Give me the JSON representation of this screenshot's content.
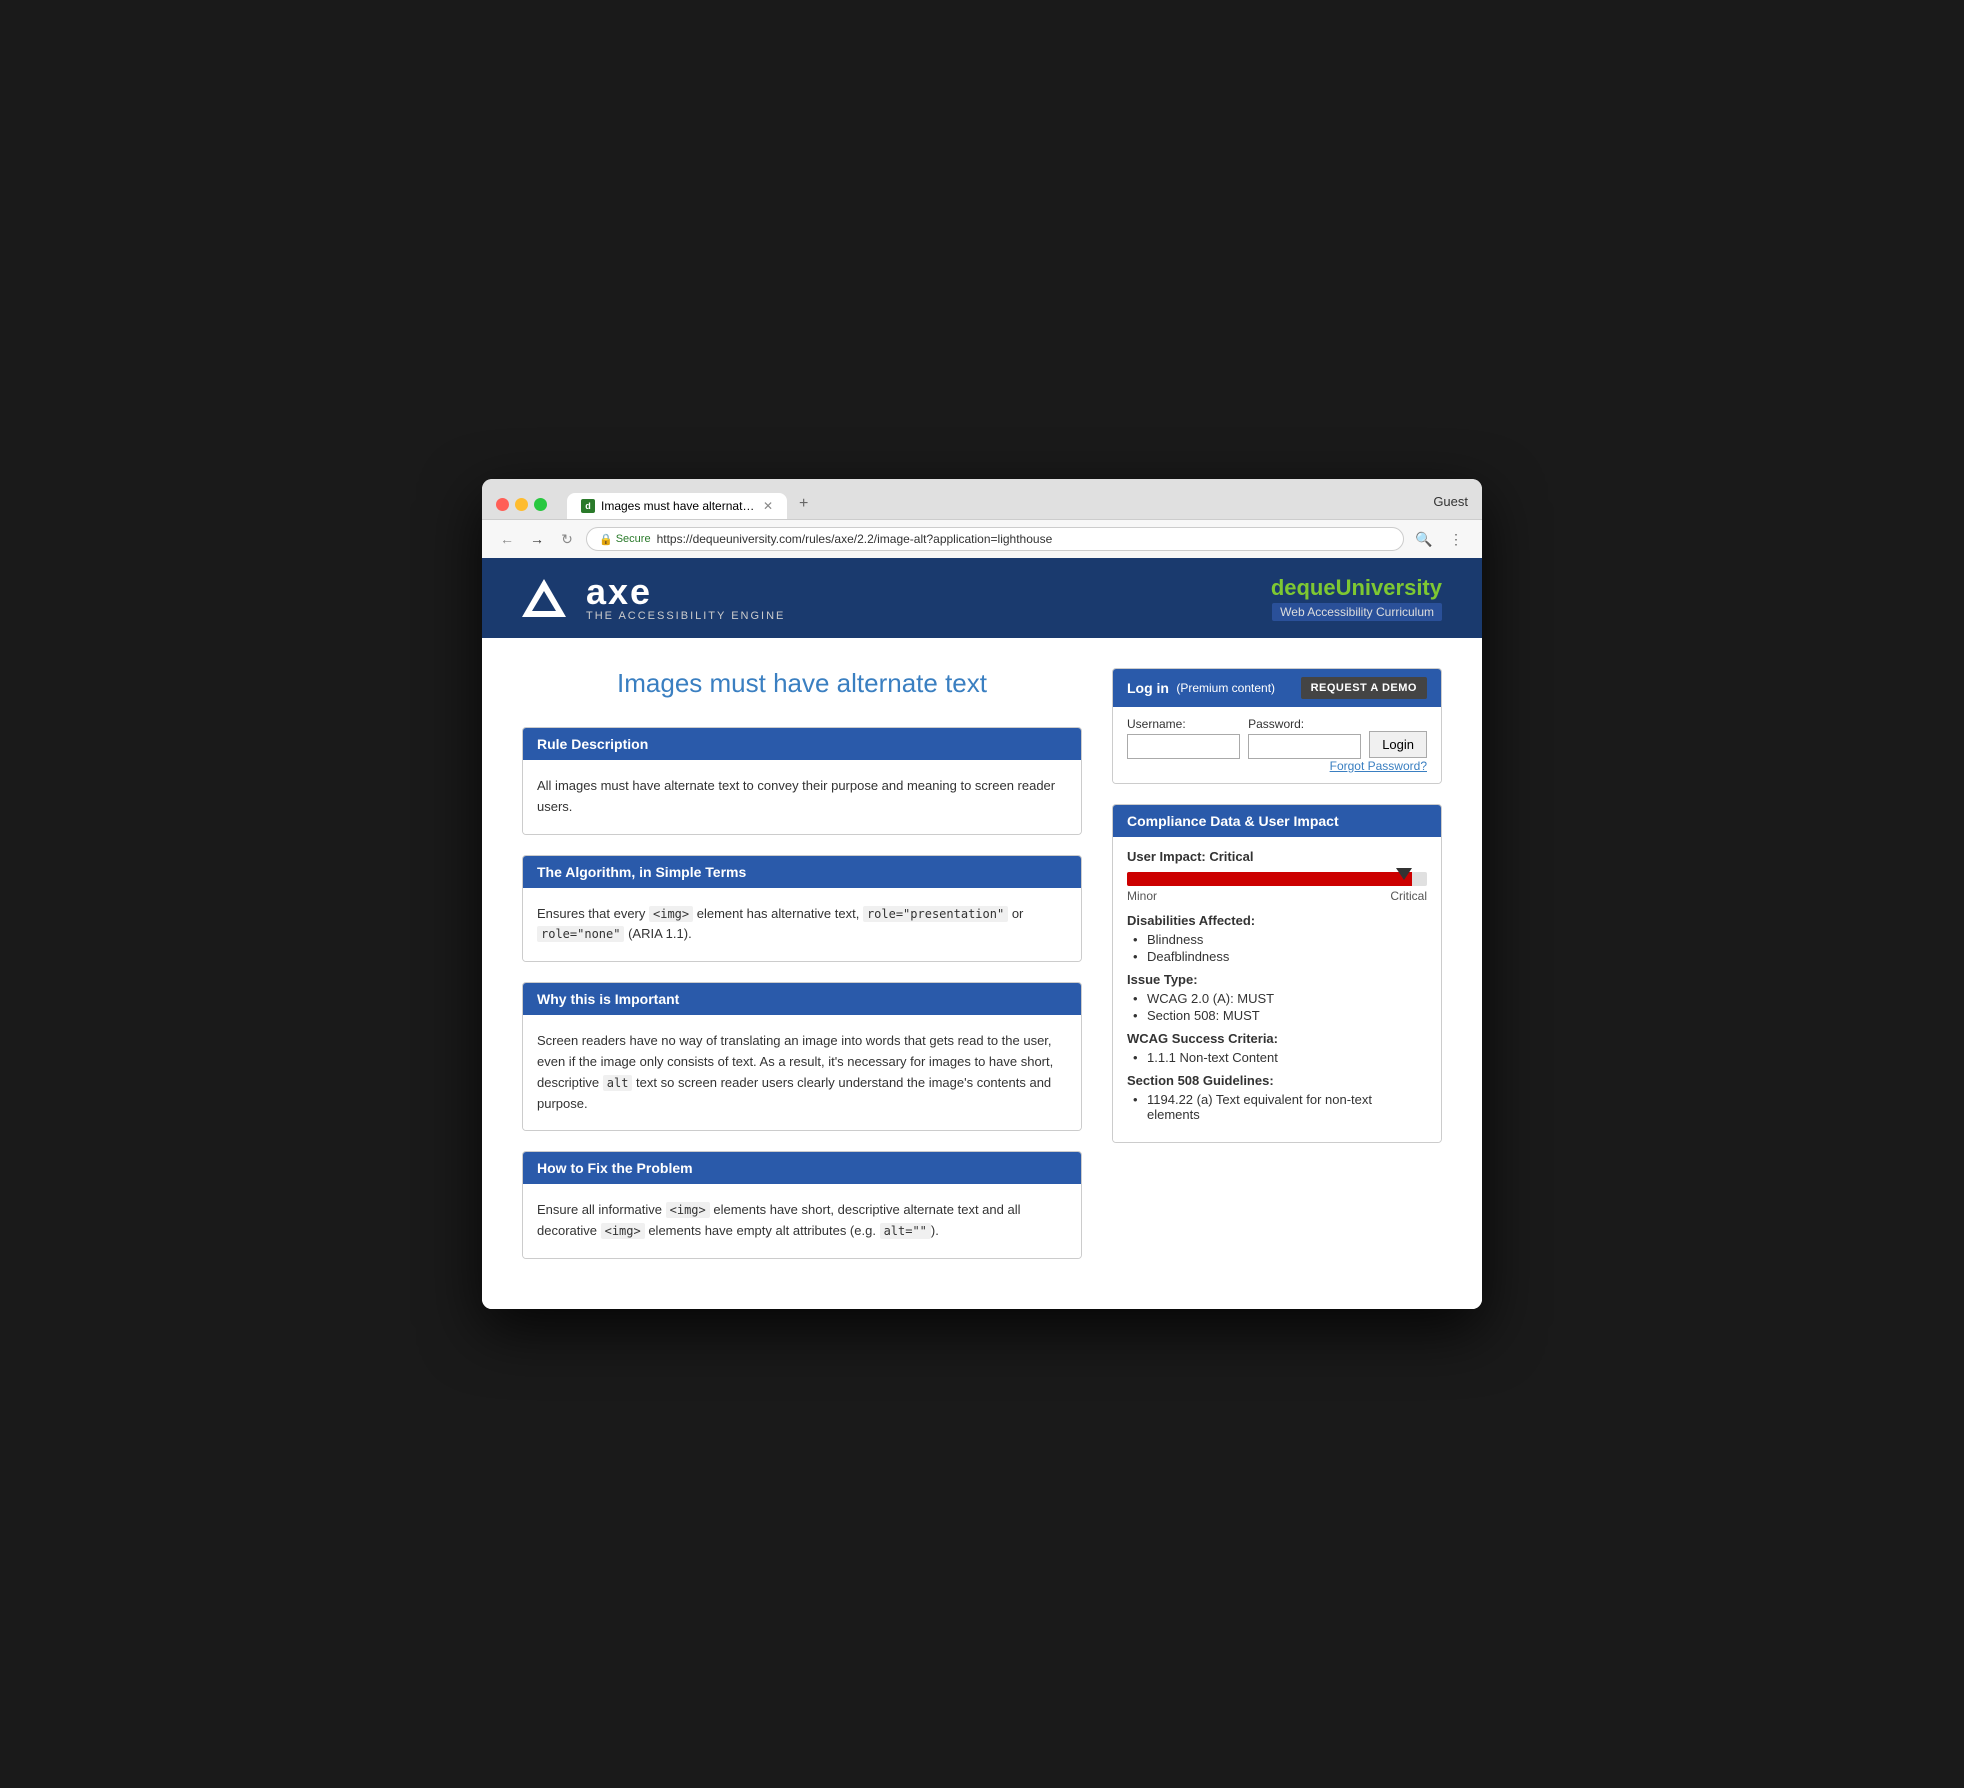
{
  "browser": {
    "tab_title": "Images must have alternate te...",
    "tab_favicon": "d",
    "guest_label": "Guest",
    "url_secure": "Secure",
    "url_full": "https://dequeuniversity.com/rules/axe/2.2/image-alt?application=lighthouse",
    "url_domain": "dequeuniversity.com",
    "url_path": "/rules/axe/2.2/image-alt?application=lighthouse"
  },
  "header": {
    "axe_name": "axe",
    "axe_subtitle": "THE ACCESSIBILITY ENGINE",
    "deque_logo_left": "deque",
    "deque_logo_right": "University",
    "deque_subtitle": "Web Accessibility Curriculum"
  },
  "page": {
    "title": "Images must have alternate text"
  },
  "login": {
    "header_title": "Log in",
    "header_subtitle": "(Premium content)",
    "request_demo": "REQUEST A DEMO",
    "username_label": "Username:",
    "password_label": "Password:",
    "login_button": "Login",
    "forgot_password": "Forgot Password?"
  },
  "sections": [
    {
      "id": "rule-description",
      "header": "Rule Description",
      "body": "All images must have alternate text to convey their purpose and meaning to screen reader users."
    },
    {
      "id": "algorithm",
      "header": "The Algorithm, in Simple Terms",
      "body_html": "Ensures that every <img> element has alternative text, role=\"presentation\" or role=\"none\" (ARIA 1.1)."
    },
    {
      "id": "why-important",
      "header": "Why this is Important",
      "body": "Screen readers have no way of translating an image into words that gets read to the user, even if the image only consists of text. As a result, it's necessary for images to have short, descriptive alt text so screen reader users clearly understand the image's contents and purpose."
    },
    {
      "id": "how-to-fix",
      "header": "How to Fix the Problem",
      "body_html": "Ensure all informative <img> elements have short, descriptive alternate text and all decorative <img> elements have empty alt attributes (e.g. alt=\"\")."
    }
  ],
  "compliance": {
    "header": "Compliance Data & User Impact",
    "user_impact_label": "User Impact: Critical",
    "slider_min": "Minor",
    "slider_max": "Critical",
    "slider_fill_pct": 95,
    "disabilities_title": "Disabilities Affected:",
    "disabilities": [
      "Blindness",
      "Deafblindness"
    ],
    "issue_type_title": "Issue Type:",
    "issue_types": [
      "WCAG 2.0 (A): MUST",
      "Section 508: MUST"
    ],
    "wcag_title": "WCAG Success Criteria:",
    "wcag_items": [
      "1.1.1 Non-text Content"
    ],
    "section508_title": "Section 508 Guidelines:",
    "section508_items": [
      "1194.22 (a) Text equivalent for non-text elements"
    ]
  }
}
